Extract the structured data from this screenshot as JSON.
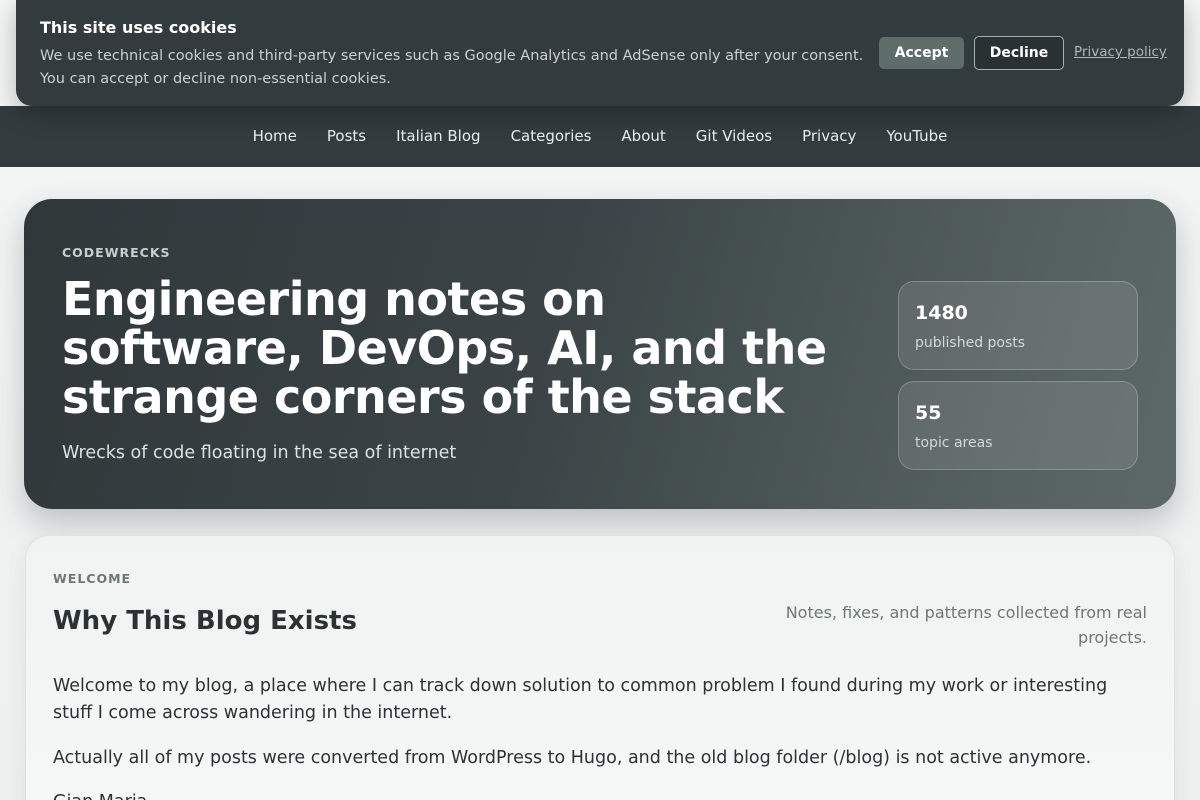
{
  "cookie_banner": {
    "title": "This site uses cookies",
    "text": "We use technical cookies and third-party services such as Google Analytics and AdSense only after your consent. You can accept or decline non-essential cookies.",
    "accept_label": "Accept",
    "decline_label": "Decline",
    "privacy_label": "Privacy policy"
  },
  "nav": {
    "items": [
      {
        "label": "Home"
      },
      {
        "label": "Posts"
      },
      {
        "label": "Italian Blog"
      },
      {
        "label": "Categories"
      },
      {
        "label": "About"
      },
      {
        "label": "Git Videos"
      },
      {
        "label": "Privacy"
      },
      {
        "label": "YouTube"
      }
    ]
  },
  "hero": {
    "kicker": "CODEWRECKS",
    "title": "Engineering notes on software, DevOps, AI, and the strange corners of the stack",
    "subtitle": "Wrecks of code floating in the sea of internet",
    "stats": [
      {
        "value": "1480",
        "label": "published posts"
      },
      {
        "value": "55",
        "label": "topic areas"
      }
    ]
  },
  "welcome": {
    "kicker": "WELCOME",
    "title": "Why This Blog Exists",
    "aside": "Notes, fixes, and patterns collected from real projects.",
    "paragraphs": [
      "Welcome to my blog, a place where I can track down solution to common problem I found during my work or interesting stuff I come across wandering in the internet.",
      "Actually all of my posts were converted from WordPress to Hugo, and the old blog folder (/blog) is not active anymore.",
      "Gian Maria"
    ]
  },
  "colors": {
    "nav_bg": "#323b3d",
    "accept_bg": "#5e6d69",
    "hero_gradient_start": "#2f3739",
    "hero_gradient_end": "#5d6967"
  }
}
